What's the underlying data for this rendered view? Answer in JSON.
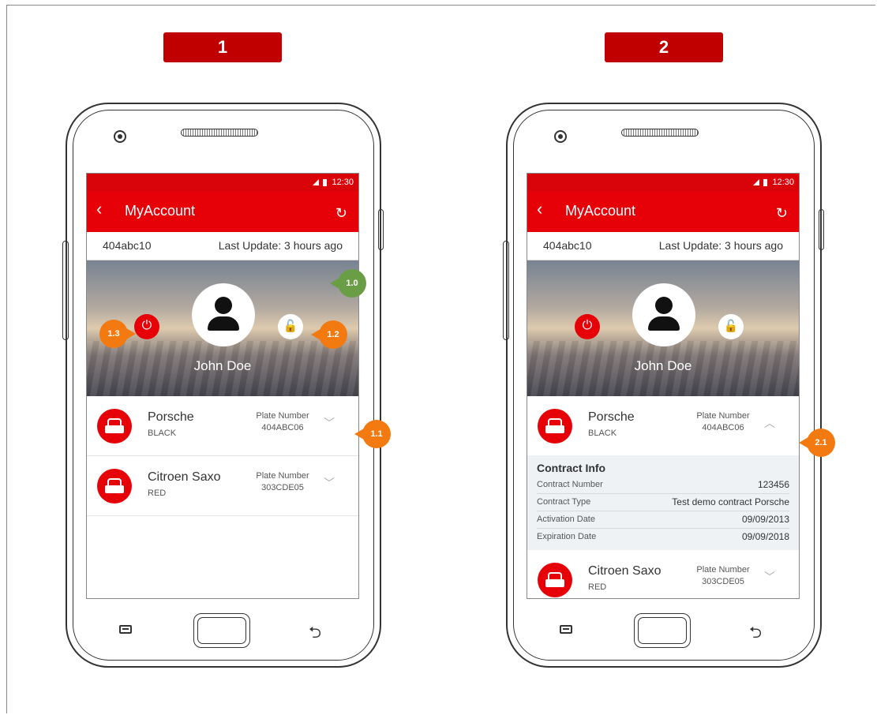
{
  "steps": [
    {
      "label": "1"
    },
    {
      "label": "2"
    }
  ],
  "screens": [
    {
      "status_time": "12:30",
      "app_title": "MyAccount",
      "account_id": "404abc10",
      "last_update": "Last Update: 3 hours ago",
      "user_name": "John Doe",
      "cars": [
        {
          "make": "Porsche",
          "color": "BLACK",
          "plate_label": "Plate Number",
          "plate": "404ABC06",
          "chevron": "﹀"
        },
        {
          "make": "Citroen Saxo",
          "color": "RED",
          "plate_label": "Plate Number",
          "plate": "303CDE05",
          "chevron": "﹀"
        }
      ]
    },
    {
      "status_time": "12:30",
      "app_title": "MyAccount",
      "account_id": "404abc10",
      "last_update": "Last Update: 3 hours ago",
      "user_name": "John Doe",
      "cars": [
        {
          "make": "Porsche",
          "color": "BLACK",
          "plate_label": "Plate Number",
          "plate": "404ABC06",
          "chevron": "︿"
        },
        {
          "make": "Citroen Saxo",
          "color": "RED",
          "plate_label": "Plate Number",
          "plate": "303CDE05",
          "chevron": "﹀"
        }
      ],
      "contract": {
        "title": "Contract Info",
        "rows": [
          {
            "label": "Contract Number",
            "value": "123456"
          },
          {
            "label": "Contract Type",
            "value": "Test demo contract Porsche"
          },
          {
            "label": "Activation Date",
            "value": "09/09/2013"
          },
          {
            "label": "Expiration Date",
            "value": "09/09/2018"
          }
        ]
      }
    }
  ],
  "annotations": {
    "a10": "1.0",
    "a11": "1.1",
    "a12": "1.2",
    "a13": "1.3",
    "a21": "2.1"
  },
  "icons": {
    "back": "‹",
    "refresh": "↻",
    "power": "⏻",
    "lock": "🔓",
    "back_key": "⮌"
  },
  "colors": {
    "brand_red": "#e60007",
    "step_label_red": "#c00000",
    "annotation_orange": "#f27a10",
    "annotation_green": "#6a9e46",
    "contract_bg": "#eef2f5"
  }
}
